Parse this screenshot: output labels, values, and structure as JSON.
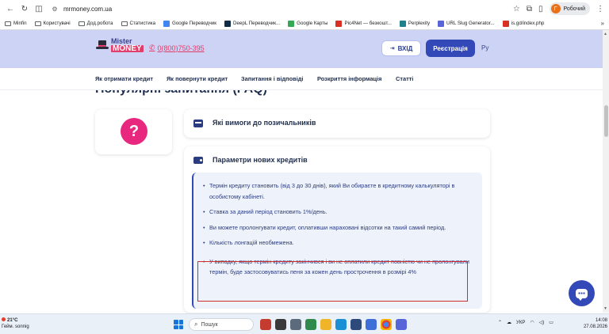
{
  "browser": {
    "url": "mrmoney.com.ua",
    "profile_initial": "Г",
    "profile_label": "Робочий"
  },
  "bookmarks": [
    {
      "label": "Minfin",
      "icon": "folder-icon"
    },
    {
      "label": "Користувачі",
      "icon": "folder-icon"
    },
    {
      "label": "Дод.робота",
      "icon": "folder-icon"
    },
    {
      "label": "Статистика",
      "icon": "folder-icon"
    },
    {
      "label": "Google Переводчик",
      "icon": "translate-icon"
    },
    {
      "label": "DeepL Переводчик...",
      "icon": "deepl-icon"
    },
    {
      "label": "Google Карты",
      "icon": "maps-icon"
    },
    {
      "label": "Pic4Net — безкошт...",
      "icon": "pic4net-icon"
    },
    {
      "label": "Perplexity",
      "icon": "perplexity-icon"
    },
    {
      "label": "URL Slug Generator...",
      "icon": "slug-icon"
    },
    {
      "label": "is.gd/index.php",
      "icon": "isgd-icon"
    }
  ],
  "site": {
    "logo_line1": "Mister",
    "logo_line2": "MONEY",
    "phone": "0(800)750-395",
    "login_label": "ВХІД",
    "register_label": "Реєстрація",
    "lang_label": "Ру"
  },
  "nav": [
    "Як отримати кредит",
    "Як повернути кредит",
    "Запитання і відповіді",
    "Розкриття інформація",
    "Статті"
  ],
  "page": {
    "heading_partial": "Популярні запитання (FAQ)",
    "question_mark": "?",
    "acc1_title": "Які вимоги до позичальників",
    "acc2_title": "Параметри нових кредитів",
    "items": [
      "Термін кредиту становить (від 3 до 30 днів), який Ви обираєте в кредитному калькуляторі в особистому кабінеті.",
      "Ставка за даний період становить 1%/день.",
      "Ви можете пролонгувати кредит, оплативши нараховані відсотки на такий самий період.",
      "Кількість лонгацій необмежена.",
      "У випадку, якщо термін кредиту закінчився і ви не оплатили кредит повністю чи не пролонгували термін, буде застосовуватись пеня за кожен день прострочення в розмірі 4%"
    ]
  },
  "taskbar": {
    "temp": "21°C",
    "weather": "Гейм. sonnig",
    "search_placeholder": "Пошук",
    "lang": "УКР",
    "time": "14:08",
    "date": "27.08.2026"
  },
  "colors": {
    "header_bg": "#ccd3f5",
    "brand_blue": "#3449b8",
    "brand_pink": "#e8277e",
    "highlight_red": "#d22b2b"
  }
}
